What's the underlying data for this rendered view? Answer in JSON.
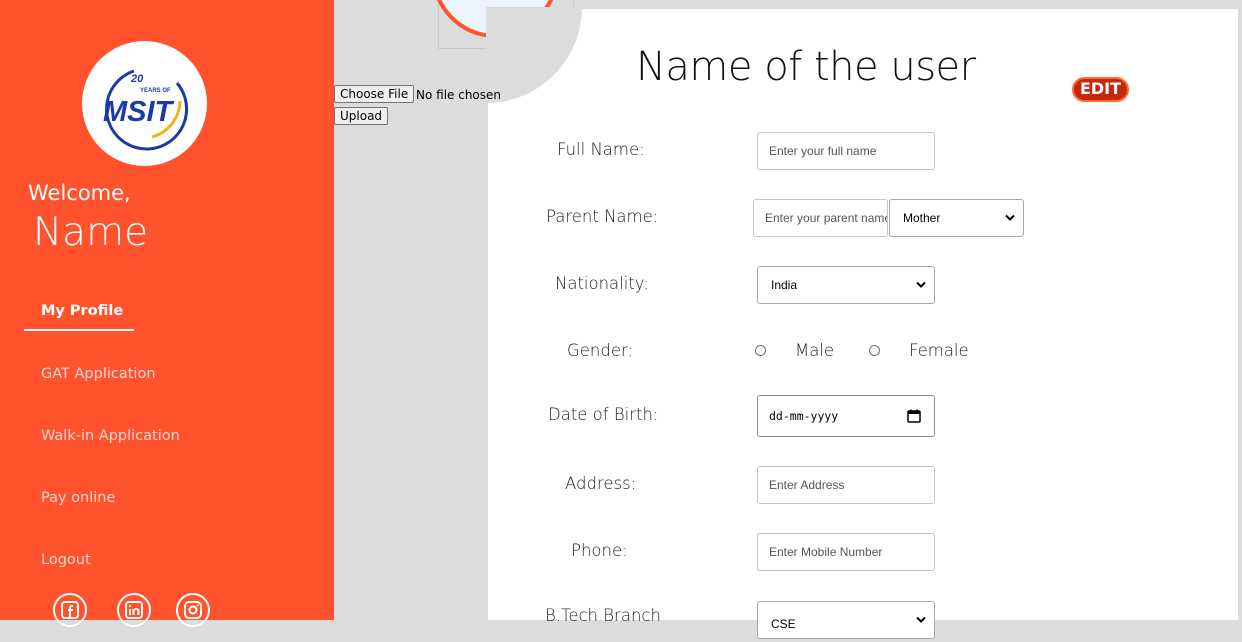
{
  "sidebar": {
    "logo": {
      "text": "MSIT",
      "badge": "20",
      "badge_caption": "YEARS OF"
    },
    "welcome": "Welcome,",
    "user_name": "Name",
    "nav": [
      {
        "label": "My Profile",
        "active": true
      },
      {
        "label": "GAT Application"
      },
      {
        "label": "Walk-in Application"
      },
      {
        "label": "Pay online"
      },
      {
        "label": "Logout"
      }
    ],
    "social": [
      "facebook-icon",
      "linkedin-icon",
      "instagram-icon"
    ],
    "color": "#ff522d"
  },
  "upload": {
    "choose_file_label": "Choose File",
    "no_file_text": "No file chosen",
    "upload_label": "Upload"
  },
  "profile": {
    "title": "Name of the user",
    "edit_label": "EDIT",
    "fields": {
      "full_name": {
        "label": "Full Name:",
        "placeholder": "Enter your full name"
      },
      "parent_name": {
        "label": "Parent Name:",
        "placeholder": "Enter your parent name",
        "relation": "Mother"
      },
      "nationality": {
        "label": "Nationality:",
        "value": "India"
      },
      "gender": {
        "label": "Gender:",
        "options": [
          "Male",
          "Female"
        ]
      },
      "dob": {
        "label": "Date of Birth:",
        "placeholder": "dd-mm-yyyy"
      },
      "address": {
        "label": "Address:",
        "placeholder": "Enter Address"
      },
      "phone": {
        "label": "Phone:",
        "placeholder": "Enter Mobile Number"
      },
      "branch": {
        "label": "B.Tech Branch",
        "value": "CSE"
      }
    }
  }
}
